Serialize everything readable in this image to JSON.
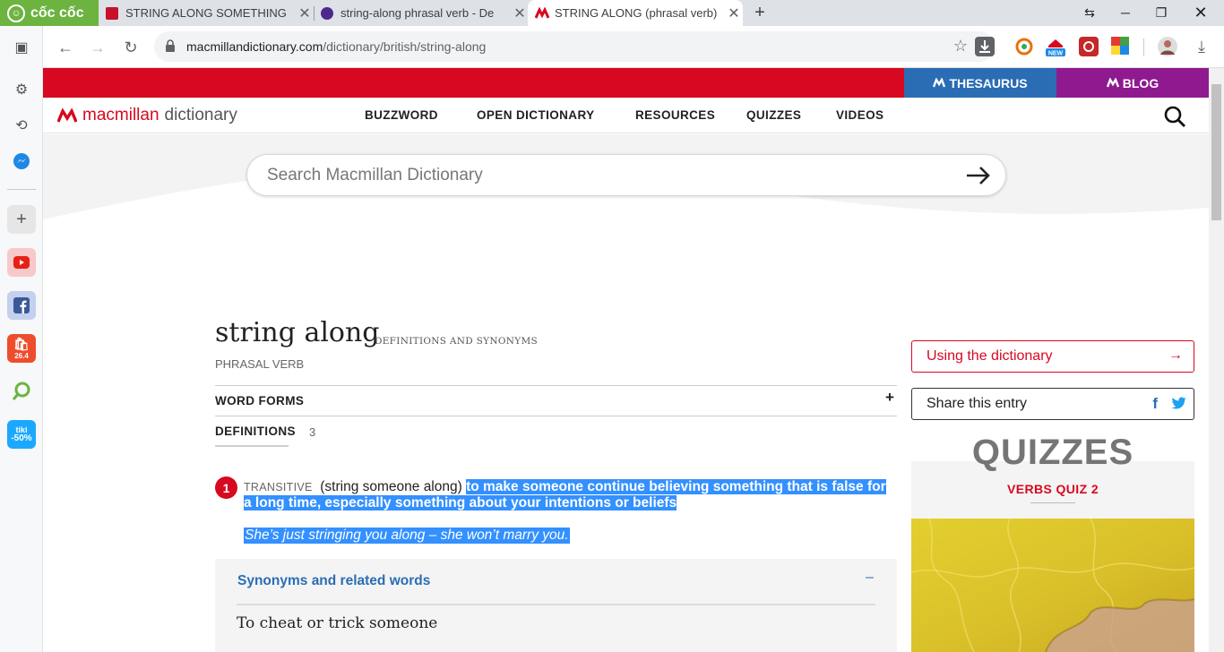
{
  "browser": {
    "brand": "cốc cốc",
    "tabs": [
      {
        "title": "STRING ALONG SOMETHING"
      },
      {
        "title": "string-along phrasal verb - De"
      },
      {
        "title": "STRING ALONG (phrasal verb)"
      }
    ],
    "url_host": "macmillandictionary.com",
    "url_path": "/dictionary/british/string-along",
    "extensions": [
      "coccoc-extension-icon",
      "new-badge-icon",
      "red-extension-icon",
      "color-grid-extension-icon",
      "profile-avatar"
    ],
    "sidebar": [
      "settings-icon",
      "history-icon",
      "messenger-icon",
      "add-icon",
      "youtube-icon",
      "facebook-icon",
      "shopee-icon",
      "lens-icon",
      "tiki-icon"
    ],
    "tiki_label_top": "tiki",
    "tiki_label_bottom": "-50%",
    "shopee_label": "26.4"
  },
  "site": {
    "thesaurus_label": "THESAURUS",
    "blog_label": "BLOG",
    "logo_word1": "macmillan",
    "logo_word2": "dictionary",
    "nav": [
      "BUZZWORD",
      "OPEN DICTIONARY",
      "RESOURCES",
      "QUIZZES",
      "VIDEOS"
    ],
    "search_placeholder": "Search Macmillan Dictionary",
    "colors": {
      "red": "#d7081f",
      "blue": "#2a6db4",
      "purple": "#8f1a8f",
      "selection": "#3390ff"
    }
  },
  "entry": {
    "headword": "string along",
    "headword_sub": "DEFINITIONS AND SYNONYMS",
    "part_of_speech": "PHRASAL VERB",
    "word_forms_label": "WORD FORMS",
    "word_forms_toggle": "+",
    "definitions_label": "DEFINITIONS",
    "definitions_count": "3",
    "sense": {
      "number": "1",
      "grammar": "TRANSITIVE",
      "pattern": "(string someone along)",
      "definition": "to make someone continue believing something that is false for a long time, especially something about your intentions or beliefs",
      "example": "She’s just stringing you along – she won’t marry you."
    },
    "synonyms_title": "Synonyms and related words",
    "synonyms_toggle": "–",
    "synonyms_subheading": "To cheat or trick someone"
  },
  "sidebar_right": {
    "using_label": "Using the dictionary",
    "using_arrow": "→",
    "share_label": "Share this entry",
    "share_fb": "f",
    "quiz_title": "QUIZZES",
    "quiz_sub": "VERBS QUIZ 2"
  }
}
